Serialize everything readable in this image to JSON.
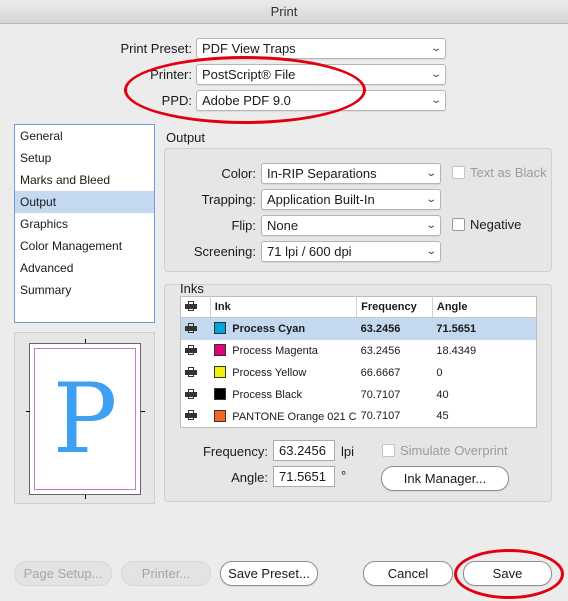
{
  "window": {
    "title": "Print"
  },
  "general": {
    "print_preset_label": "Print Preset:",
    "print_preset_value": "PDF View Traps",
    "printer_label": "Printer:",
    "printer_value": "PostScript® File",
    "ppd_label": "PPD:",
    "ppd_value": "Adobe PDF 9.0"
  },
  "sidebar": {
    "items": [
      "General",
      "Setup",
      "Marks and Bleed",
      "Output",
      "Graphics",
      "Color Management",
      "Advanced",
      "Summary"
    ],
    "selected": "Output"
  },
  "preview": {
    "letter": "P"
  },
  "output": {
    "section_title": "Output",
    "color_label": "Color:",
    "color_value": "In-RIP Separations",
    "text_as_black_label": "Text as Black",
    "trapping_label": "Trapping:",
    "trapping_value": "Application Built-In",
    "flip_label": "Flip:",
    "flip_value": "None",
    "negative_label": "Negative",
    "screening_label": "Screening:",
    "screening_value": "71 lpi / 600 dpi"
  },
  "inks": {
    "section_title": "Inks",
    "columns": [
      "Ink",
      "Frequency",
      "Angle"
    ],
    "rows": [
      {
        "name": "Process Cyan",
        "frequency": "63.2456",
        "angle": "71.5651",
        "color": "#00a6e0"
      },
      {
        "name": "Process Magenta",
        "frequency": "63.2456",
        "angle": "18.4349",
        "color": "#e0007a"
      },
      {
        "name": "Process Yellow",
        "frequency": "66.6667",
        "angle": "0",
        "color": "#f5ee0b"
      },
      {
        "name": "Process Black",
        "frequency": "70.7107",
        "angle": "40",
        "color": "#000000"
      },
      {
        "name": "PANTONE Orange 021 C",
        "frequency": "70.7107",
        "angle": "45",
        "color": "#f26522"
      }
    ],
    "selected_row": 0,
    "frequency_label": "Frequency:",
    "frequency_value": "63.2456",
    "frequency_unit": "lpi",
    "angle_label": "Angle:",
    "angle_value": "71.5651",
    "angle_unit": "°",
    "simulate_overprint_label": "Simulate Overprint",
    "ink_manager_label": "Ink Manager..."
  },
  "footer": {
    "page_setup_label": "Page Setup...",
    "printer_label": "Printer...",
    "save_preset_label": "Save Preset...",
    "cancel_label": "Cancel",
    "save_label": "Save"
  },
  "annotation_color": "#e00010"
}
